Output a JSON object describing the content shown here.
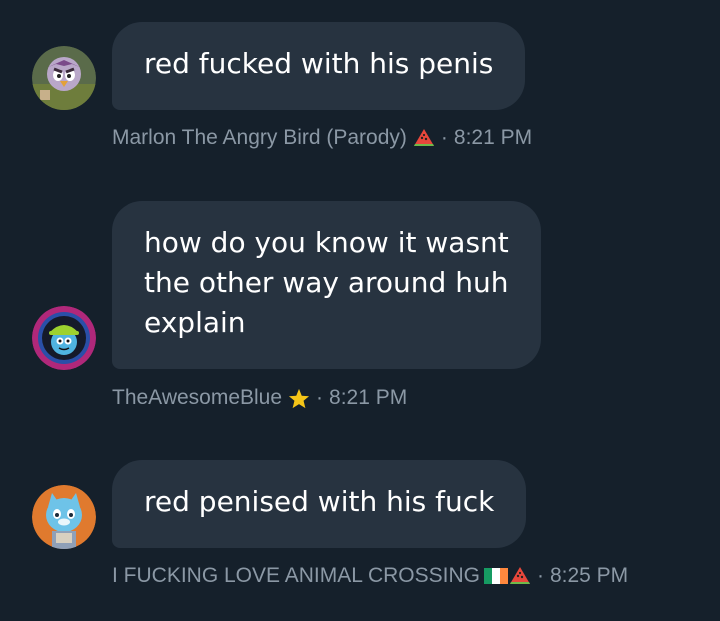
{
  "messages": [
    {
      "text_lines": [
        "red fucked with his penis"
      ],
      "author": "Marlon The Angry Bird (Parody)",
      "badge_icons": [
        "watermelon-icon"
      ],
      "time": "8:21 PM",
      "separator": "·"
    },
    {
      "text_lines": [
        "how do you know it wasnt",
        "the other way around huh",
        "explain"
      ],
      "author": "TheAwesomeBlue",
      "badge_icons": [
        "star-icon"
      ],
      "time": "8:21 PM",
      "separator": "·"
    },
    {
      "text_lines": [
        "red penised with his fuck"
      ],
      "author": "I FUCKING LOVE ANIMAL CROSSING",
      "badge_icons": [
        "ireland-flag-icon",
        "watermelon-icon"
      ],
      "time": "8:25 PM",
      "separator": "·"
    }
  ],
  "colors": {
    "background": "#15202b",
    "bubble": "#273340",
    "text": "#ffffff",
    "meta": "#8b98a5"
  }
}
